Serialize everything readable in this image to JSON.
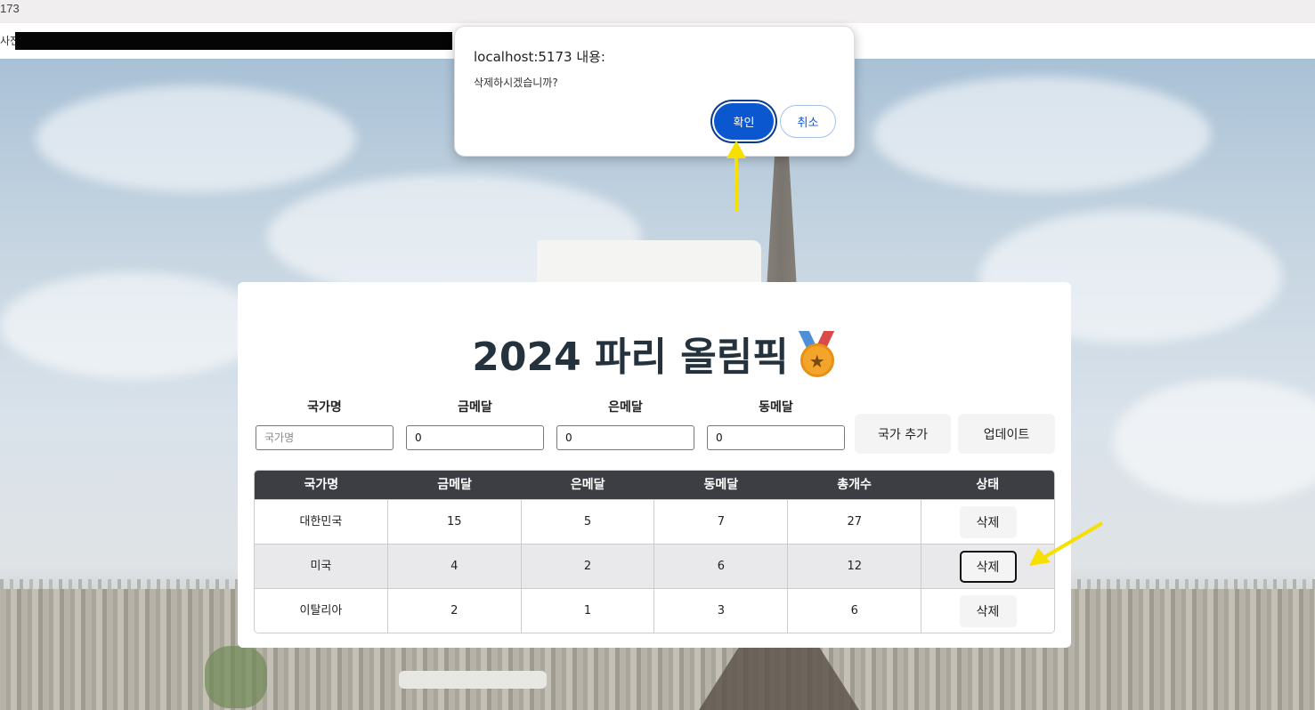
{
  "browser": {
    "url_fragment": "173",
    "bookmarks_label": "사전"
  },
  "page": {
    "title": "2024 파리 올림픽",
    "form": {
      "country_label": "국가명",
      "gold_label": "금메달",
      "silver_label": "은메달",
      "bronze_label": "동메달",
      "country_placeholder": "국가명",
      "country_value": "",
      "gold_value": "0",
      "silver_value": "0",
      "bronze_value": "0",
      "add_button": "국가 추가",
      "update_button": "업데이트"
    },
    "table": {
      "headers": [
        "국가명",
        "금메달",
        "은메달",
        "동메달",
        "총개수",
        "상태"
      ],
      "rows": [
        {
          "country": "대한민국",
          "gold": "15",
          "silver": "5",
          "bronze": "7",
          "total": "27",
          "action": "삭제"
        },
        {
          "country": "미국",
          "gold": "4",
          "silver": "2",
          "bronze": "6",
          "total": "12",
          "action": "삭제"
        },
        {
          "country": "이탈리아",
          "gold": "2",
          "silver": "1",
          "bronze": "3",
          "total": "6",
          "action": "삭제"
        }
      ]
    }
  },
  "dialog": {
    "title": "localhost:5173 내용:",
    "message": "삭제하시겠습니까?",
    "ok": "확인",
    "cancel": "취소"
  },
  "colors": {
    "accent": "#0b57d0",
    "table_header": "#3d3d44",
    "title_text": "#24323e",
    "arrow": "#f5e000"
  },
  "icons": [
    "medal-icon"
  ]
}
